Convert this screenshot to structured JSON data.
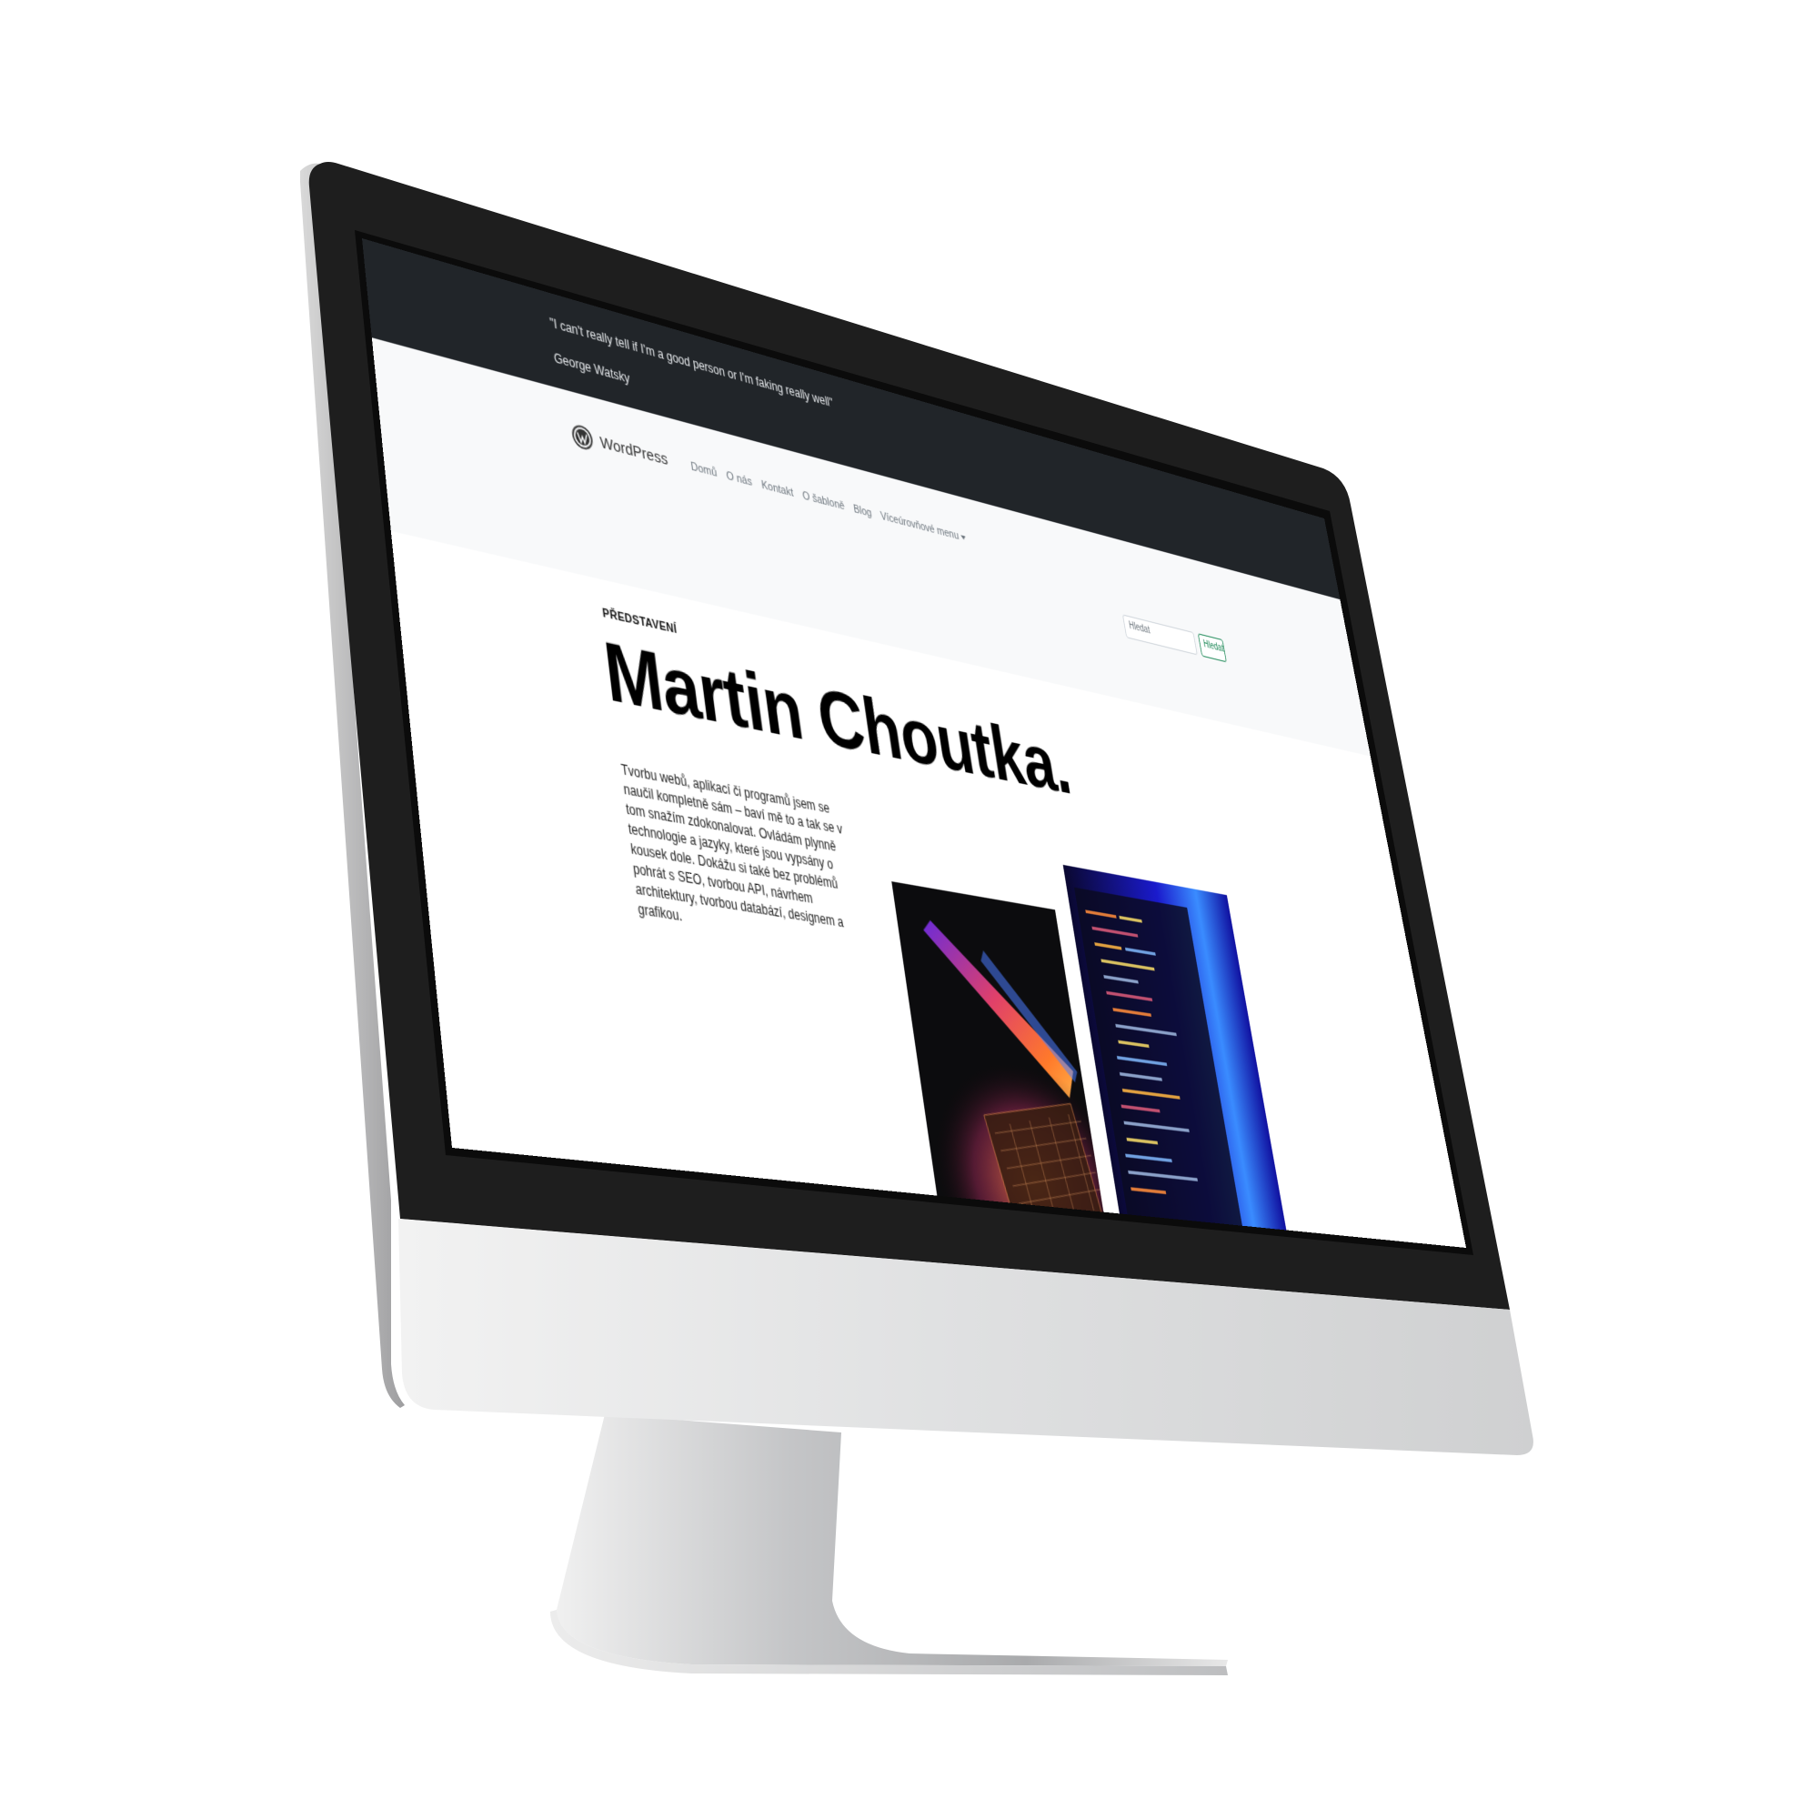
{
  "top_bar": {
    "quote": "\"I can't really tell if I'm a good person or I'm faking really well\"",
    "author": "George Watsky"
  },
  "navbar": {
    "brand": "WordPress",
    "brand_icon": "wordpress-logo-icon",
    "links": [
      "Domů",
      "O nás",
      "Kontakt",
      "O šabloně",
      "Blog",
      "Víceúrovňové menu"
    ],
    "search_placeholder": "Hledat",
    "search_button": "Hledat"
  },
  "hero": {
    "label": "PŘEDSTAVENÍ",
    "title": "Martin Choutka.",
    "description": "Tvorbu webů, aplikací či programů jsem se naučil kompletně sám – baví mě to a tak se v tom snažím zdokonalovat. Ovládám plynně technologie a jazyky, které jsou vypsány o kousek dole. Dokážu si také bez problémů pohrát s SEO, tvorbou API, návrhem architektury, tvorbou databází, designem a grafikou."
  },
  "photos": [
    "laptop-keyboard-photo",
    "code-screen-photo"
  ],
  "colors": {
    "topbar": "#212529",
    "navbar": "#f8f9fa",
    "search_accent": "#198754",
    "bezel": "#1e1e1e",
    "chin": "#e6e7e8",
    "stand": "#c9cacc"
  }
}
